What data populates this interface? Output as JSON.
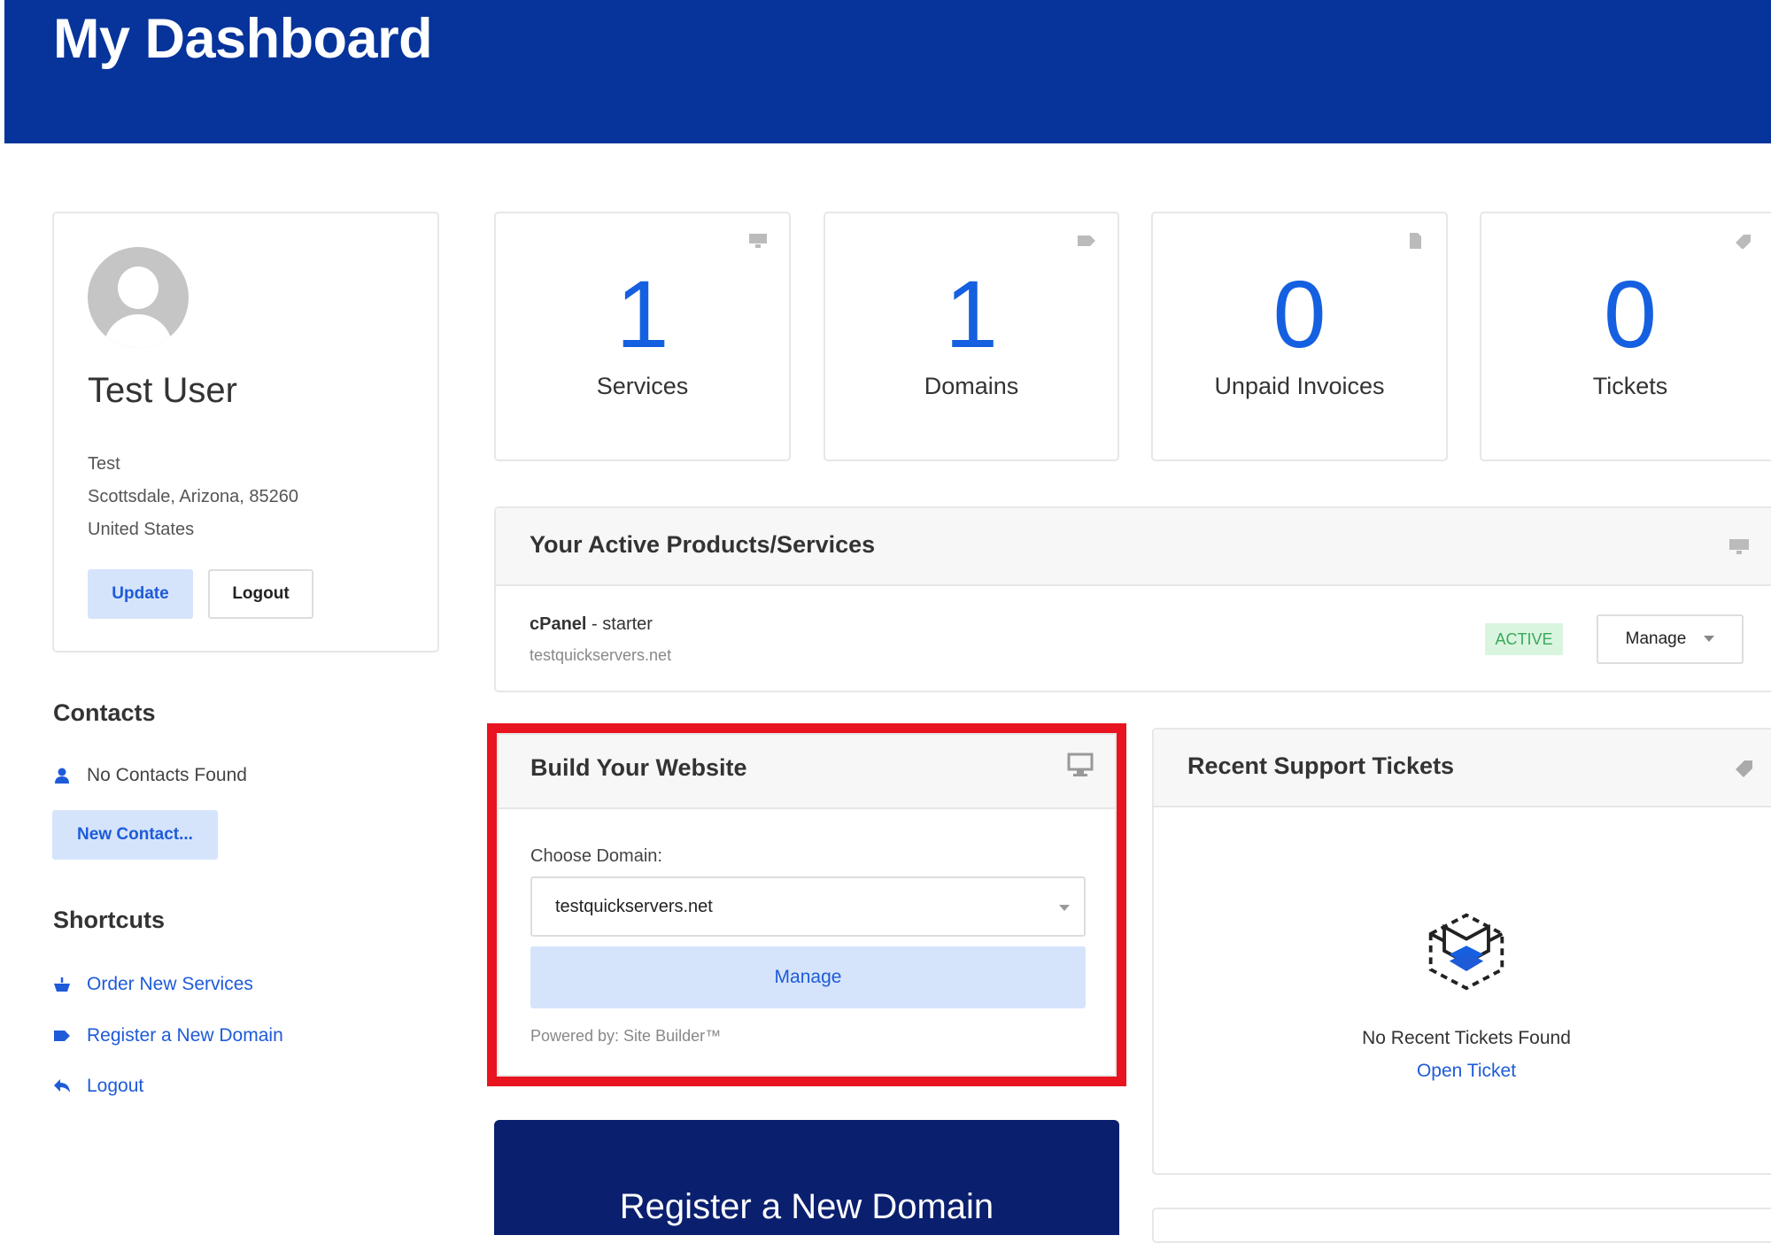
{
  "header": {
    "title": "My Dashboard"
  },
  "profile": {
    "name": "Test User",
    "company": "Test",
    "location": "Scottsdale, Arizona, 85260",
    "country": "United States",
    "update_label": "Update",
    "logout_label": "Logout"
  },
  "contacts": {
    "heading": "Contacts",
    "empty_text": "No Contacts Found",
    "new_label": "New Contact..."
  },
  "shortcuts": {
    "heading": "Shortcuts",
    "items": [
      {
        "label": "Order New Services",
        "icon": "basket-icon"
      },
      {
        "label": "Register a New Domain",
        "icon": "tag-icon"
      },
      {
        "label": "Logout",
        "icon": "reply-arrow-icon"
      }
    ]
  },
  "stats": [
    {
      "value": "1",
      "label": "Services",
      "icon": "monitor-icon"
    },
    {
      "value": "1",
      "label": "Domains",
      "icon": "tag-icon"
    },
    {
      "value": "0",
      "label": "Unpaid Invoices",
      "icon": "document-icon"
    },
    {
      "value": "0",
      "label": "Tickets",
      "icon": "ticket-icon"
    }
  ],
  "active_products": {
    "title": "Your Active Products/Services",
    "product_name": "cPanel",
    "product_plan": " - starter",
    "product_domain": "testquickservers.net",
    "status": "ACTIVE",
    "manage_label": "Manage"
  },
  "site_builder": {
    "title": "Build Your Website",
    "choose_label": "Choose Domain:",
    "selected_domain": "testquickservers.net",
    "manage_label": "Manage",
    "powered_by": "Powered by: Site Builder™"
  },
  "support_tickets": {
    "title": "Recent Support Tickets",
    "empty_text": "No Recent Tickets Found",
    "open_label": "Open Ticket"
  },
  "register_domain": {
    "title": "Register a New Domain"
  },
  "colors": {
    "header": "#07349b",
    "accent": "#1560e0",
    "highlight_border": "#e8141f",
    "register_bg": "#0a1f6e"
  }
}
